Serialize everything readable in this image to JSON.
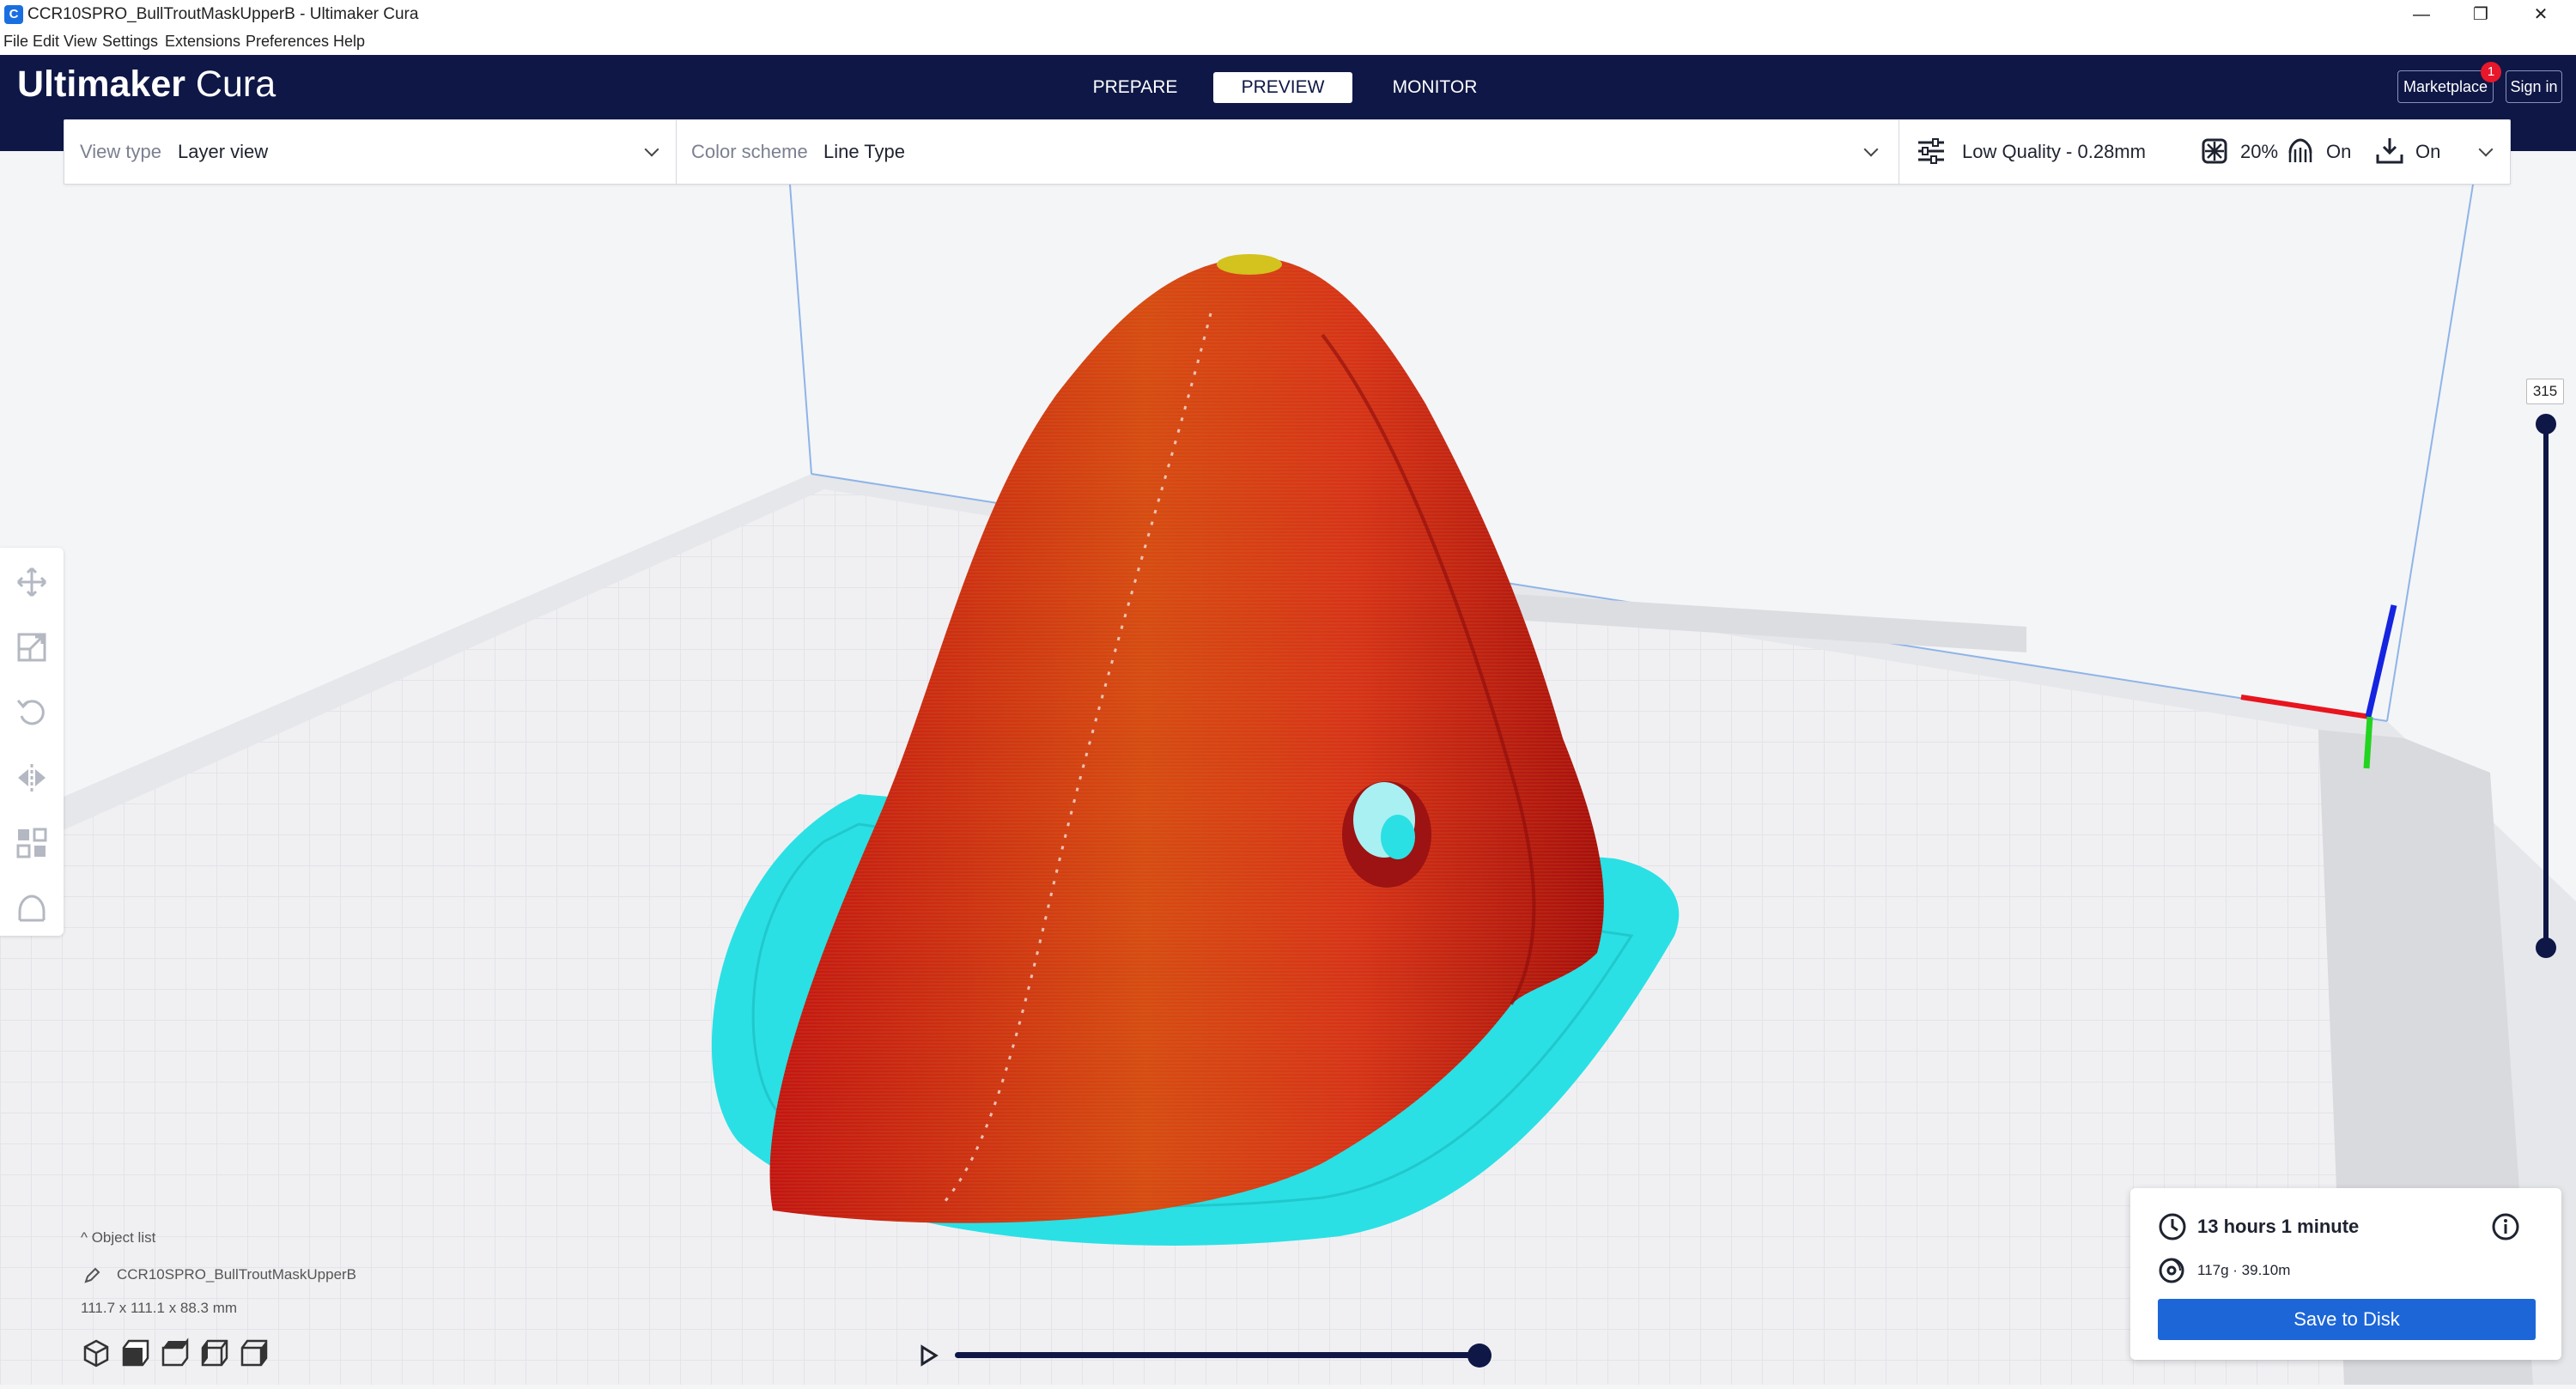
{
  "window": {
    "title": "CCR10SPRO_BullTroutMaskUpperB - Ultimaker Cura",
    "icon_letter": "C",
    "controls": {
      "minimize": "—",
      "restore": "❐",
      "close": "✕"
    }
  },
  "menu": [
    "File",
    "Edit",
    "View",
    "Settings",
    "Extensions",
    "Preferences",
    "Help"
  ],
  "header": {
    "logo_bold": "Ultimaker",
    "logo_light": " Cura",
    "stages": [
      "PREPARE",
      "PREVIEW",
      "MONITOR"
    ],
    "active_stage": "PREVIEW",
    "marketplace_label": "Marketplace",
    "marketplace_badge": "1",
    "signin_label": "Sign in"
  },
  "toolbar": {
    "view_type_label": "View type",
    "view_type_value": "Layer view",
    "color_scheme_label": "Color scheme",
    "color_scheme_value": "Line Type",
    "profile": "Low Quality - 0.28mm",
    "infill": "20%",
    "support": "On",
    "adhesion": "On"
  },
  "left_tools": [
    "move-icon",
    "scale-icon",
    "rotate-icon",
    "mirror-icon",
    "per-model-settings-icon",
    "support-blocker-icon"
  ],
  "layer_slider": {
    "current_layer": "315",
    "level": 1.0
  },
  "object_list": {
    "toggle_label": "Object list",
    "object_name": "CCR10SPRO_BullTroutMaskUpperB",
    "dimensions": "111.7 x 111.1 x 88.3 mm"
  },
  "camera_views": [
    "3d-view-icon",
    "front-view-icon",
    "top-view-icon",
    "left-view-icon",
    "right-view-icon"
  ],
  "playback": {
    "position": 1.0
  },
  "print_info": {
    "time": "13 hours 1 minute",
    "material": "117g · 39.10m",
    "save_label": "Save to Disk"
  },
  "colors": {
    "header": "#0e1746",
    "accent": "#1c66d8",
    "wall": "#e01e1e",
    "skirt": "#2ae0e4"
  }
}
